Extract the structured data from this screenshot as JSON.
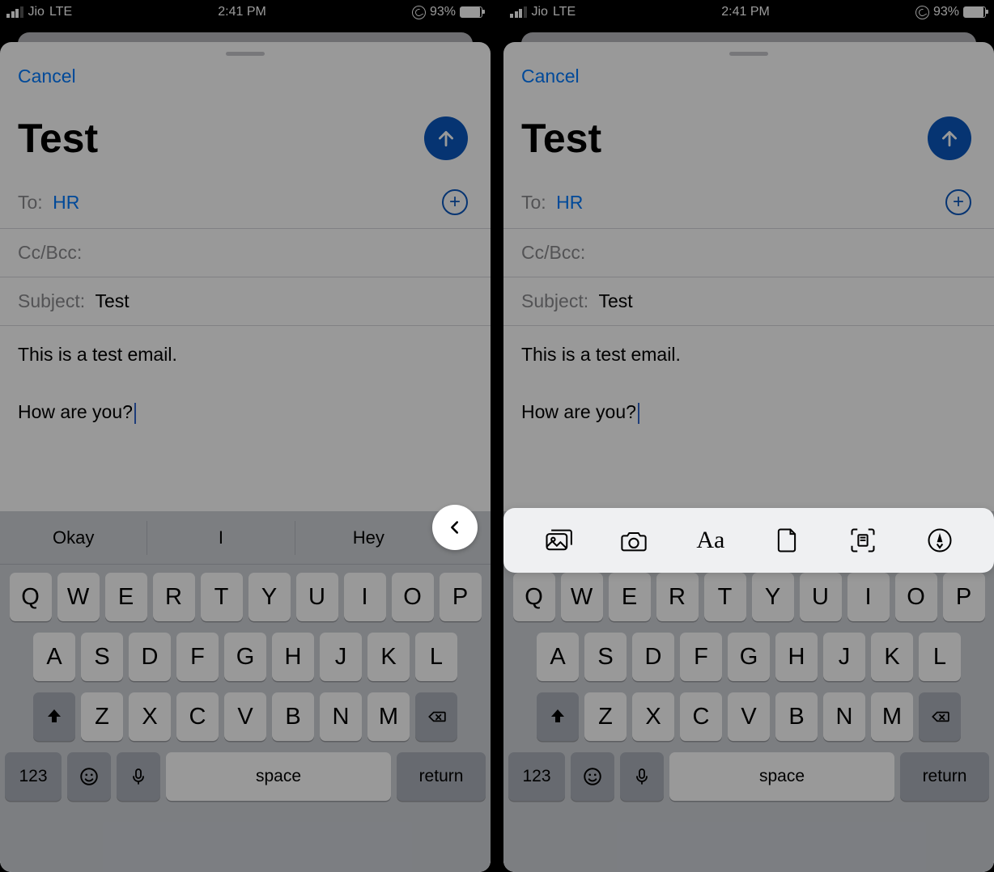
{
  "status": {
    "carrier": "Jio",
    "network": "LTE",
    "time": "2:41 PM",
    "battery_pct": "93%"
  },
  "compose": {
    "cancel": "Cancel",
    "title": "Test",
    "to_label": "To:",
    "to_value": "HR",
    "cc_label": "Cc/Bcc:",
    "subject_label": "Subject:",
    "subject_value": "Test",
    "body_line1": "This is a test email.",
    "body_line2": "How are you?"
  },
  "suggestions": [
    "Okay",
    "I",
    "Hey"
  ],
  "format_icons": [
    "photo-library-icon",
    "camera-icon",
    "text-format-icon",
    "document-icon",
    "scan-icon",
    "markup-icon"
  ],
  "keyboard": {
    "row1": [
      "Q",
      "W",
      "E",
      "R",
      "T",
      "Y",
      "U",
      "I",
      "O",
      "P"
    ],
    "row2": [
      "A",
      "S",
      "D",
      "F",
      "G",
      "H",
      "J",
      "K",
      "L"
    ],
    "row3": [
      "Z",
      "X",
      "C",
      "V",
      "B",
      "N",
      "M"
    ],
    "num": "123",
    "space": "space",
    "return": "return"
  }
}
